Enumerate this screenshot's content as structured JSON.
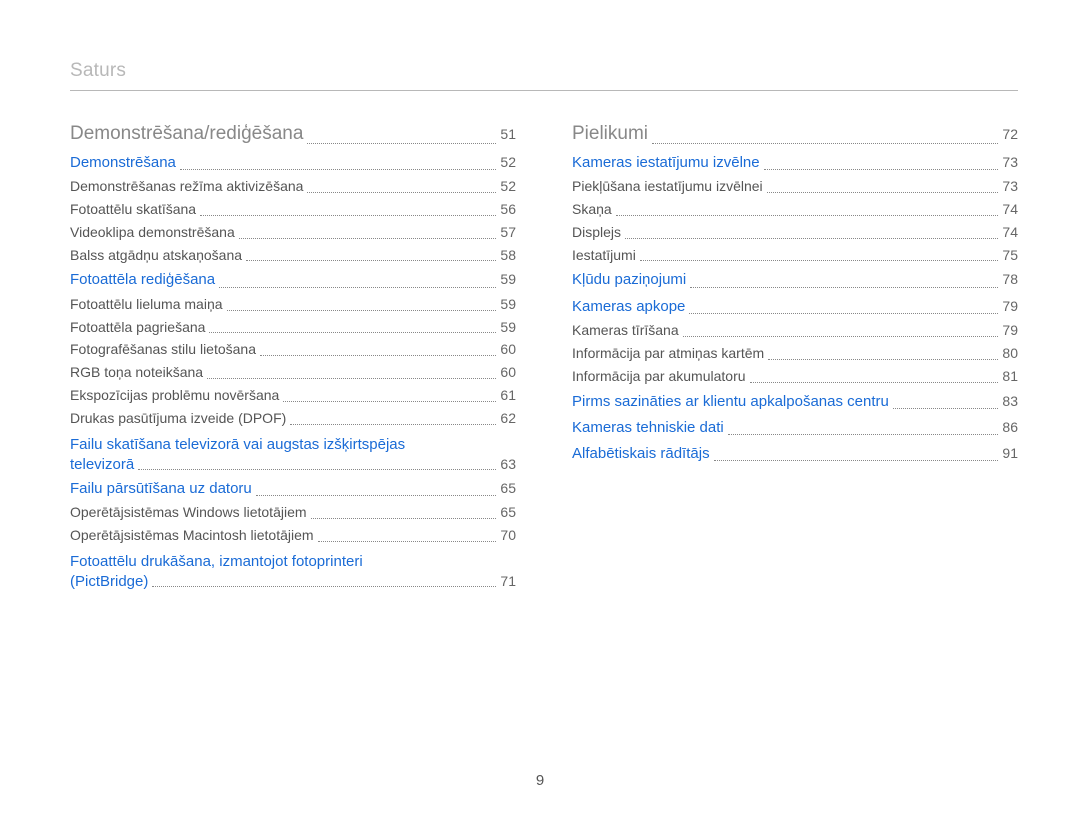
{
  "header": {
    "title": "Saturs"
  },
  "page_number": "9",
  "left": [
    {
      "label": "Demonstrēšana/rediģēšana",
      "page": "51",
      "level": 0
    },
    {
      "label": "Demonstrēšana",
      "page": "52",
      "level": 1
    },
    {
      "label": "Demonstrēšanas režīma aktivizēšana",
      "page": "52",
      "level": 2
    },
    {
      "label": "Fotoattēlu skatīšana",
      "page": "56",
      "level": 2
    },
    {
      "label": "Videoklipa demonstrēšana",
      "page": "57",
      "level": 2
    },
    {
      "label": "Balss atgādņu atskaņošana",
      "page": "58",
      "level": 2
    },
    {
      "label": "Fotoattēla rediģēšana",
      "page": "59",
      "level": 1
    },
    {
      "label": "Fotoattēlu lieluma maiņa",
      "page": "59",
      "level": 2
    },
    {
      "label": "Fotoattēla pagriešana",
      "page": "59",
      "level": 2
    },
    {
      "label": "Fotografēšanas stilu lietošana",
      "page": "60",
      "level": 2
    },
    {
      "label": "RGB toņa noteikšana",
      "page": "60",
      "level": 2
    },
    {
      "label": "Ekspozīcijas problēmu novēršana",
      "page": "61",
      "level": 2
    },
    {
      "label": "Drukas pasūtījuma izveide (DPOF)",
      "page": "62",
      "level": 2
    },
    {
      "label_a": "Failu skatīšana televizorā vai augstas izšķirtspējas",
      "label_b": "televizorā",
      "page": "63",
      "level": 1,
      "multi": true
    },
    {
      "label": "Failu pārsūtīšana uz datoru",
      "page": "65",
      "level": 1
    },
    {
      "label": "Operētājsistēmas Windows lietotājiem",
      "page": "65",
      "level": 2
    },
    {
      "label": "Operētājsistēmas Macintosh lietotājiem",
      "page": "70",
      "level": 2
    },
    {
      "label_a": "Fotoattēlu drukāšana, izmantojot fotoprinteri",
      "label_b": "(PictBridge)",
      "page": "71",
      "level": 1,
      "multi": true
    }
  ],
  "right": [
    {
      "label": "Pielikumi",
      "page": "72",
      "level": 0
    },
    {
      "label": "Kameras iestatījumu izvēlne",
      "page": "73",
      "level": 1
    },
    {
      "label": "Piekļūšana iestatījumu izvēlnei",
      "page": "73",
      "level": 2
    },
    {
      "label": "Skaņa",
      "page": "74",
      "level": 2
    },
    {
      "label": "Displejs",
      "page": "74",
      "level": 2
    },
    {
      "label": "Iestatījumi",
      "page": "75",
      "level": 2
    },
    {
      "label": "Kļūdu paziņojumi",
      "page": "78",
      "level": 1
    },
    {
      "label": "Kameras apkope",
      "page": "79",
      "level": 1
    },
    {
      "label": "Kameras tīrīšana",
      "page": "79",
      "level": 2
    },
    {
      "label": "Informācija par atmiņas kartēm",
      "page": "80",
      "level": 2
    },
    {
      "label": "Informācija par akumulatoru",
      "page": "81",
      "level": 2
    },
    {
      "label": "Pirms sazināties ar klientu apkalpošanas centru",
      "page": "83",
      "level": 1
    },
    {
      "label": "Kameras tehniskie dati",
      "page": "86",
      "level": 1
    },
    {
      "label": "Alfabētiskais rādītājs",
      "page": "91",
      "level": 1
    }
  ]
}
